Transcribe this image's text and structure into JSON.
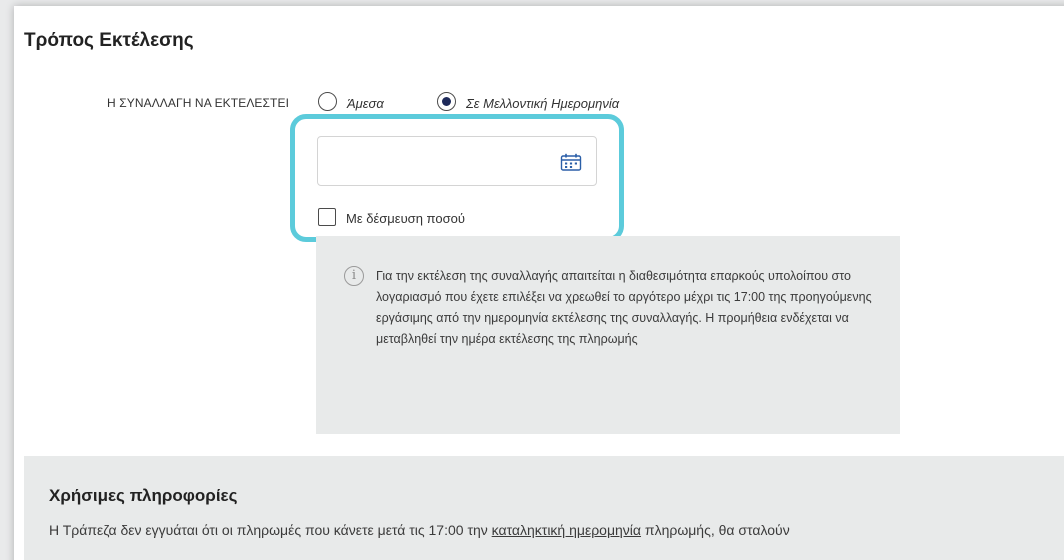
{
  "execution": {
    "title": "Τρόπος Εκτέλεσης",
    "label": "Η ΣΥΝΑΛΛΑΓΗ ΝΑ ΕΚΤΕΛΕΣΤΕΙ",
    "options": [
      {
        "label": "Άμεσα",
        "selected": false
      },
      {
        "label": "Σε Μελλοντική Ημερομηνία",
        "selected": true
      }
    ],
    "date_value": "",
    "date_icon": "calendar-icon",
    "hold_checkbox": {
      "label": "Με δέσμευση ποσού",
      "checked": false
    },
    "info_icon": "info-icon",
    "info_symbol": "i",
    "info_text": "Για την εκτέλεση της συναλλαγής απαιτείται η διαθεσιμότητα επαρκούς υπολοίπου στο λογαριασμό που έχετε επιλέξει να χρεωθεί το αργότερο μέχρι τις 17:00 της προηγούμενης εργάσιμης από την ημερομηνία εκτέλεσης της συναλλαγής. Η προμήθεια ενδέχεται να μεταβληθεί την ημέρα εκτέλεσης της πληρωμής"
  },
  "useful_info": {
    "title": "Χρήσιμες πληροφορίες",
    "text_before": "Η Τράπεζα δεν εγγυάται ότι οι πληρωμές που κάνετε μετά τις 17:00 την ",
    "link_text": "καταληκτική ημερομηνία",
    "text_after": " πληρωμής, θα σταλούν"
  },
  "colors": {
    "highlight": "#5ccbdb",
    "radio_selected": "#1e2a5a",
    "calendar_icon": "#2b5fa8",
    "info_background": "#e8eaea"
  }
}
